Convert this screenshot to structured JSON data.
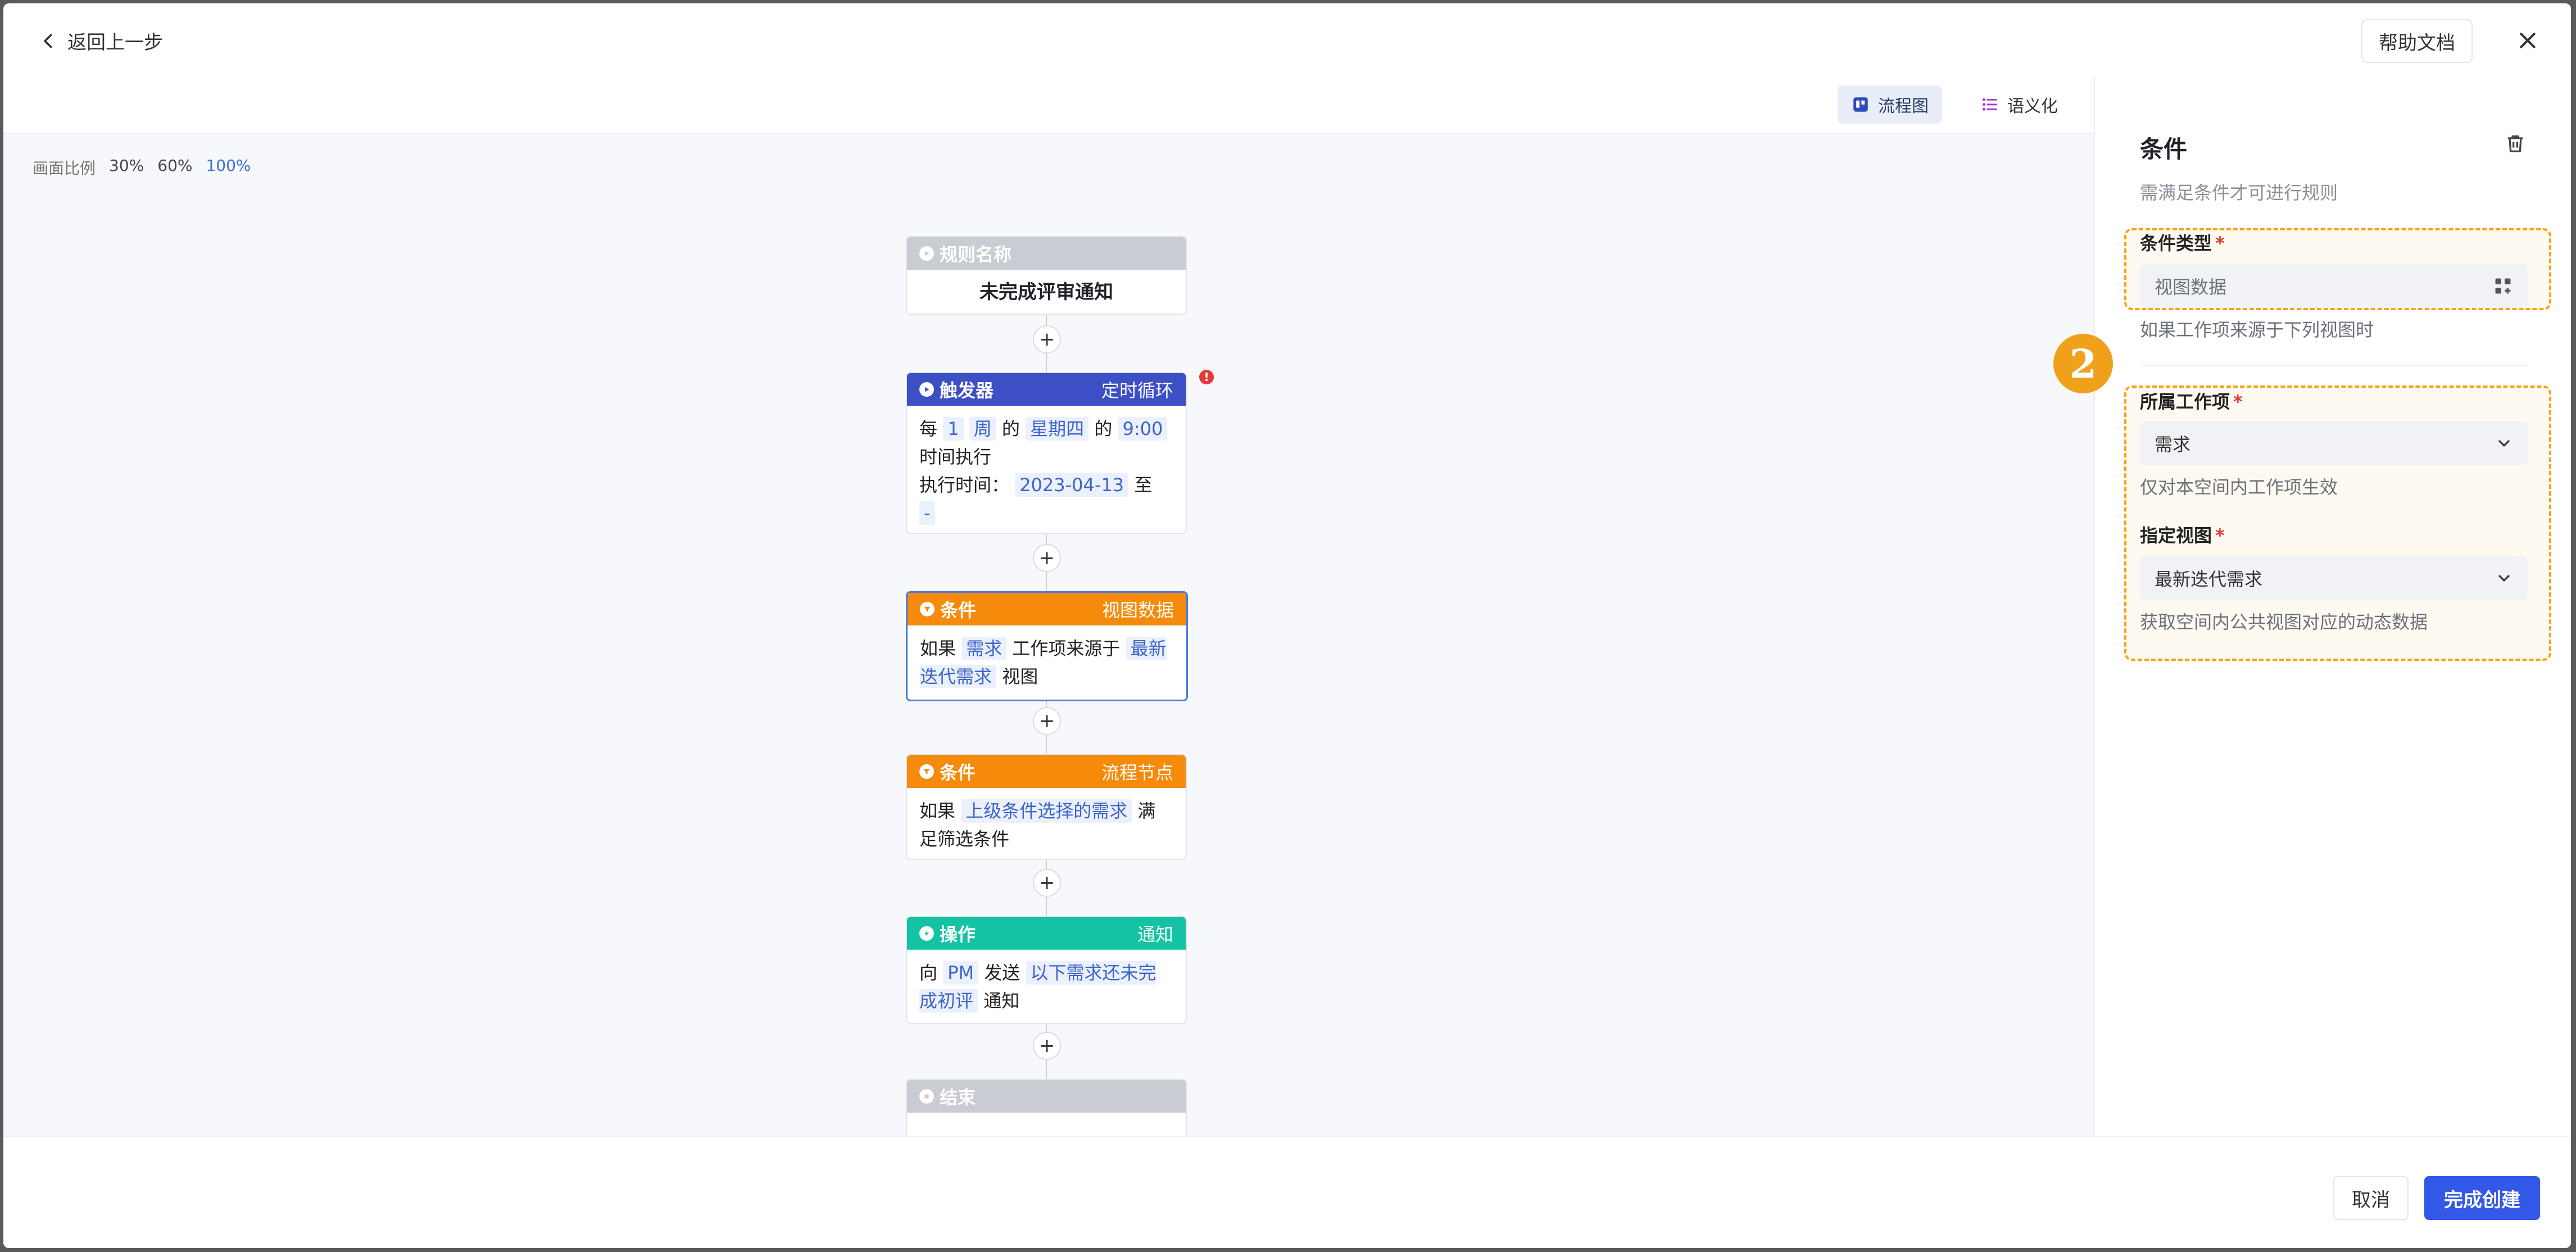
{
  "header": {
    "back_label": "返回上一步",
    "help_label": "帮助文档"
  },
  "toolbar": {
    "view_flow": "流程图",
    "view_semantic": "语义化"
  },
  "zoom": {
    "label": "画面比例",
    "options": [
      "30%",
      "60%",
      "100%"
    ],
    "active": "100%"
  },
  "flow": {
    "rule": {
      "head": "规则名称",
      "body": "未完成评审通知"
    },
    "trigger": {
      "head": "触发器",
      "tag": "定时循环",
      "alert": "!",
      "t1": "每",
      "v1": "1",
      "t2": "周",
      "t3": "的",
      "v2": "星期四",
      "t4": "的",
      "v3": "9:00",
      "t5": "时间执行",
      "t6": "执行时间：",
      "v4": "2023-04-13",
      "t7": "至",
      "v5": "-"
    },
    "cond1": {
      "head": "条件",
      "tag": "视图数据",
      "t1": "如果",
      "v1": "需求",
      "t2": "工作项来源于",
      "v2": "最新迭代需求",
      "t3": "视图"
    },
    "cond2": {
      "head": "条件",
      "tag": "流程节点",
      "t1": "如果",
      "v1": "上级条件选择的需求",
      "t2": "满足筛选条件"
    },
    "action": {
      "head": "操作",
      "tag": "通知",
      "t1": "向",
      "v1": "PM",
      "t2": "发送",
      "v2": "以下需求还未完成初评",
      "t3": "通知"
    },
    "end": {
      "head": "结束"
    },
    "plus": "+"
  },
  "panel": {
    "title": "条件",
    "subtitle": "需满足条件才可进行规则",
    "required_mark": "*",
    "condition_type": {
      "label": "条件类型",
      "value": "视图数据",
      "hint": "如果工作项来源于下列视图时"
    },
    "work_item": {
      "label": "所属工作项",
      "value": "需求",
      "hint": "仅对本空间内工作项生效"
    },
    "view": {
      "label": "指定视图",
      "value": "最新迭代需求",
      "hint": "获取空间内公共视图对应的动态数据"
    }
  },
  "annotation": {
    "step": "2"
  },
  "footer": {
    "cancel_label": "取消",
    "submit_label": "完成创建"
  },
  "colors": {
    "primary": "#3358e8",
    "trigger": "#3d4fc5",
    "condition": "#f58a0b",
    "action": "#14c2a4",
    "highlight": "#f5a316"
  }
}
